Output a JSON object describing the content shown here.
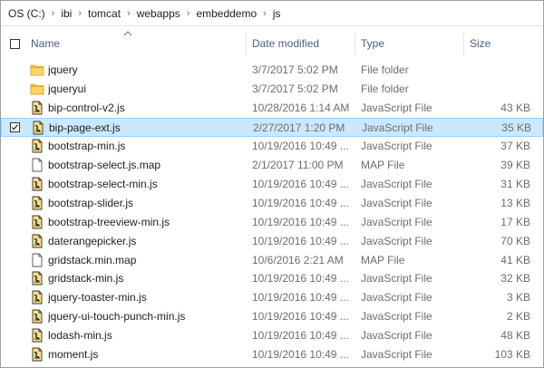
{
  "breadcrumb": [
    "OS (C:)",
    "ibi",
    "tomcat",
    "webapps",
    "embeddemo",
    "js"
  ],
  "columns": {
    "name": "Name",
    "date": "Date modified",
    "type": "Type",
    "size": "Size"
  },
  "colors": {
    "selected_bg": "#cce8ff",
    "selected_border": "#99d1ff",
    "header_text": "#4c607a",
    "folder": "#f5c34a"
  },
  "files": [
    {
      "name": "jquery",
      "date": "3/7/2017 5:02 PM",
      "type": "File folder",
      "size": "",
      "icon": "folder-icon"
    },
    {
      "name": "jqueryui",
      "date": "3/7/2017 5:02 PM",
      "type": "File folder",
      "size": "",
      "icon": "folder-icon"
    },
    {
      "name": "bip-control-v2.js",
      "date": "10/28/2016 1:14 AM",
      "type": "JavaScript File",
      "size": "43 KB",
      "icon": "js-file-icon"
    },
    {
      "name": "bip-page-ext.js",
      "date": "2/27/2017 1:20 PM",
      "type": "JavaScript File",
      "size": "35 KB",
      "icon": "js-file-icon",
      "selected": true
    },
    {
      "name": "bootstrap-min.js",
      "date": "10/19/2016 10:49 ...",
      "type": "JavaScript File",
      "size": "37 KB",
      "icon": "js-file-icon"
    },
    {
      "name": "bootstrap-select.js.map",
      "date": "2/1/2017 11:00 PM",
      "type": "MAP File",
      "size": "39 KB",
      "icon": "map-file-icon"
    },
    {
      "name": "bootstrap-select-min.js",
      "date": "10/19/2016 10:49 ...",
      "type": "JavaScript File",
      "size": "31 KB",
      "icon": "js-file-icon"
    },
    {
      "name": "bootstrap-slider.js",
      "date": "10/19/2016 10:49 ...",
      "type": "JavaScript File",
      "size": "13 KB",
      "icon": "js-file-icon"
    },
    {
      "name": "bootstrap-treeview-min.js",
      "date": "10/19/2016 10:49 ...",
      "type": "JavaScript File",
      "size": "17 KB",
      "icon": "js-file-icon"
    },
    {
      "name": "daterangepicker.js",
      "date": "10/19/2016 10:49 ...",
      "type": "JavaScript File",
      "size": "70 KB",
      "icon": "js-file-icon"
    },
    {
      "name": "gridstack.min.map",
      "date": "10/6/2016 2:21 AM",
      "type": "MAP File",
      "size": "41 KB",
      "icon": "map-file-icon"
    },
    {
      "name": "gridstack-min.js",
      "date": "10/19/2016 10:49 ...",
      "type": "JavaScript File",
      "size": "32 KB",
      "icon": "js-file-icon"
    },
    {
      "name": "jquery-toaster-min.js",
      "date": "10/19/2016 10:49 ...",
      "type": "JavaScript File",
      "size": "3 KB",
      "icon": "js-file-icon"
    },
    {
      "name": "jquery-ui-touch-punch-min.js",
      "date": "10/19/2016 10:49 ...",
      "type": "JavaScript File",
      "size": "2 KB",
      "icon": "js-file-icon"
    },
    {
      "name": "lodash-min.js",
      "date": "10/19/2016 10:49 ...",
      "type": "JavaScript File",
      "size": "48 KB",
      "icon": "js-file-icon"
    },
    {
      "name": "moment.js",
      "date": "10/19/2016 10:49 ...",
      "type": "JavaScript File",
      "size": "103 KB",
      "icon": "js-file-icon"
    }
  ]
}
